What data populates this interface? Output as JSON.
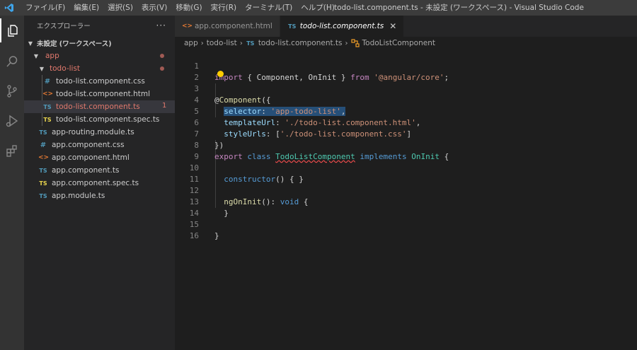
{
  "menubar": {
    "items": [
      "ファイル(F)",
      "編集(E)",
      "選択(S)",
      "表示(V)",
      "移動(G)",
      "実行(R)",
      "ターミナル(T)",
      "ヘルプ(H)"
    ]
  },
  "window_title": "todo-list.component.ts - 未設定 (ワークスペース) - Visual Studio Code",
  "sidebar": {
    "title": "エクスプローラー",
    "more": "···",
    "workspace": "未設定 (ワークスペース)",
    "folder_app": "app",
    "folder_todo": "todo-list",
    "todo_files": [
      {
        "icon": "#",
        "label": "todo-list.component.css"
      },
      {
        "icon": "<>",
        "label": "todo-list.component.html"
      },
      {
        "icon": "TS",
        "label": "todo-list.component.ts",
        "badge": "1"
      },
      {
        "icon": "TS",
        "label": "todo-list.component.spec.ts"
      }
    ],
    "app_files": [
      {
        "icon": "TS",
        "label": "app-routing.module.ts"
      },
      {
        "icon": "#",
        "label": "app.component.css"
      },
      {
        "icon": "<>",
        "label": "app.component.html"
      },
      {
        "icon": "TS",
        "label": "app.component.ts"
      },
      {
        "icon": "TS",
        "label": "app.component.spec.ts"
      },
      {
        "icon": "TS",
        "label": "app.module.ts"
      }
    ]
  },
  "tabs": [
    {
      "icon": "<>",
      "label": "app.component.html"
    },
    {
      "icon": "TS",
      "label": "todo-list.component.ts",
      "close": "✕"
    }
  ],
  "breadcrumb": {
    "items": [
      "app",
      "todo-list",
      "todo-list.component.ts",
      "TodoListComponent"
    ],
    "ts_icon": "TS"
  },
  "editor": {
    "line_numbers": [
      "1",
      "2",
      "3",
      "4",
      "5",
      "6",
      "7",
      "8",
      "9",
      "10",
      "11",
      "12",
      "13",
      "14",
      "15",
      "16"
    ],
    "code": {
      "l1": [
        "import",
        " { Component, OnInit } ",
        "from",
        " ",
        "'@angular/core'",
        ";"
      ],
      "l3": [
        "@",
        "Component",
        "({"
      ],
      "l4": [
        "selector",
        ": ",
        "'app-todo-list'",
        ","
      ],
      "l5": [
        "templateUrl",
        ": ",
        "'./todo-list.component.html'",
        ","
      ],
      "l6": [
        "styleUrls",
        ": [",
        "'./todo-list.component.css'",
        "]"
      ],
      "l7": [
        "})"
      ],
      "l8": [
        "export",
        " ",
        "class",
        " ",
        "TodoListComponent",
        " ",
        "implements",
        " ",
        "OnInit",
        " {"
      ],
      "l10": [
        "constructor",
        "() { }"
      ],
      "l12": [
        "ngOnInit",
        "(): ",
        "void",
        " {"
      ],
      "l13": [
        "}"
      ],
      "l15": [
        "}"
      ]
    }
  }
}
